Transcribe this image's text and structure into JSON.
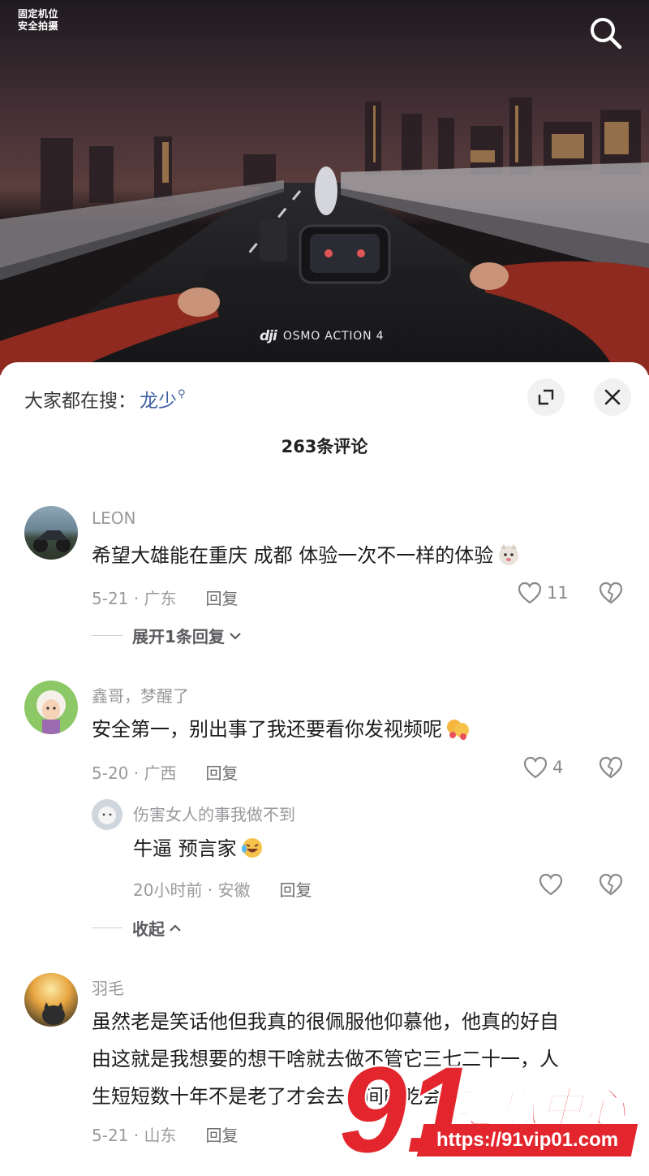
{
  "video": {
    "watermark_line1": "固定机位",
    "watermark_line2": "安全拍摄",
    "brand_logo": "dji",
    "brand_text": "OSMO ACTION 4",
    "search_icon": "search-icon"
  },
  "sheet": {
    "hot_search_prefix": "大家都在搜：",
    "hot_search_keyword": "龙少",
    "comment_count": "263条评论",
    "expand_icon": "expand-icon",
    "close_icon": "close-icon"
  },
  "comments": [
    {
      "name": "LEON",
      "text": "希望大雄能在重庆  成都 体验一次不一样的体验",
      "emoji": "cat-face-emoji",
      "date": "5-21 · 广东",
      "reply": "回复",
      "likes": "11",
      "thread_toggle": "展开1条回复"
    },
    {
      "name": "鑫哥，梦醒了",
      "text": "安全第一，别出事了我还要看你发视频呢",
      "emoji": "hug-emoji",
      "date": "5-20 · 广西",
      "reply": "回复",
      "likes": "4",
      "replies": [
        {
          "name": "伤害女人的事我做不到",
          "text": "牛逼 预言家",
          "emoji": "laughing-emoji",
          "date": "20小时前 · 安徽",
          "reply": "回复"
        }
      ],
      "thread_toggle": "收起"
    },
    {
      "name": "羽毛",
      "text_line1": "虽然老是笑话他但我真的很佩服他仰慕他，他真的好自",
      "text_line2": "由这就是我想要的想干啥就去做不管它三七二十一，人",
      "text_line3": "生短短数十年不是老了才会去人间的吃会",
      "date": "5-21 · 山东",
      "reply": "回复"
    }
  ],
  "overlay": {
    "logo_number": "91",
    "logo_text": "吃瓜中心",
    "url": "https://91vip01.com"
  }
}
